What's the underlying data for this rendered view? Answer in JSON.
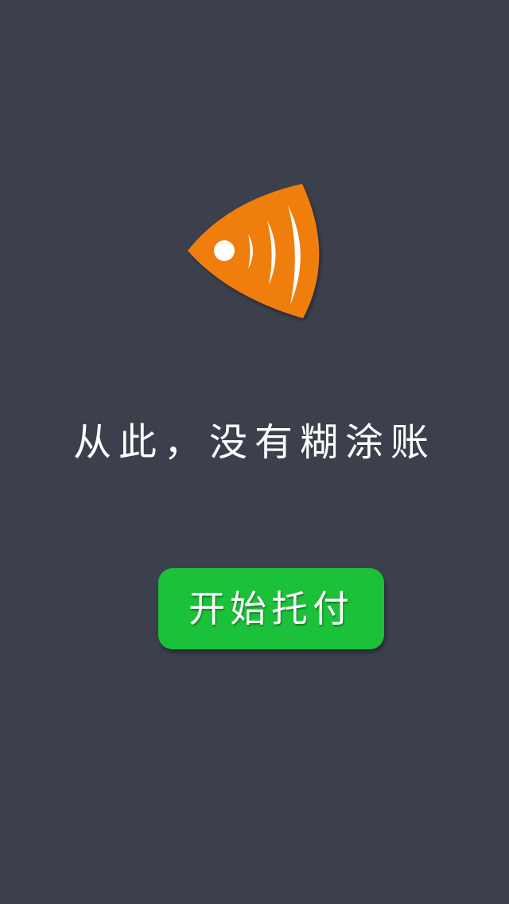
{
  "colors": {
    "background": "#3b404c",
    "logo_orange": "#f07e0c",
    "button_green": "#1cc13a",
    "text_white": "#ffffff"
  },
  "logo": {
    "icon": "orange-fish-icon"
  },
  "tagline": "从此，没有糊涂账",
  "start_button": {
    "label": "开始托付"
  }
}
